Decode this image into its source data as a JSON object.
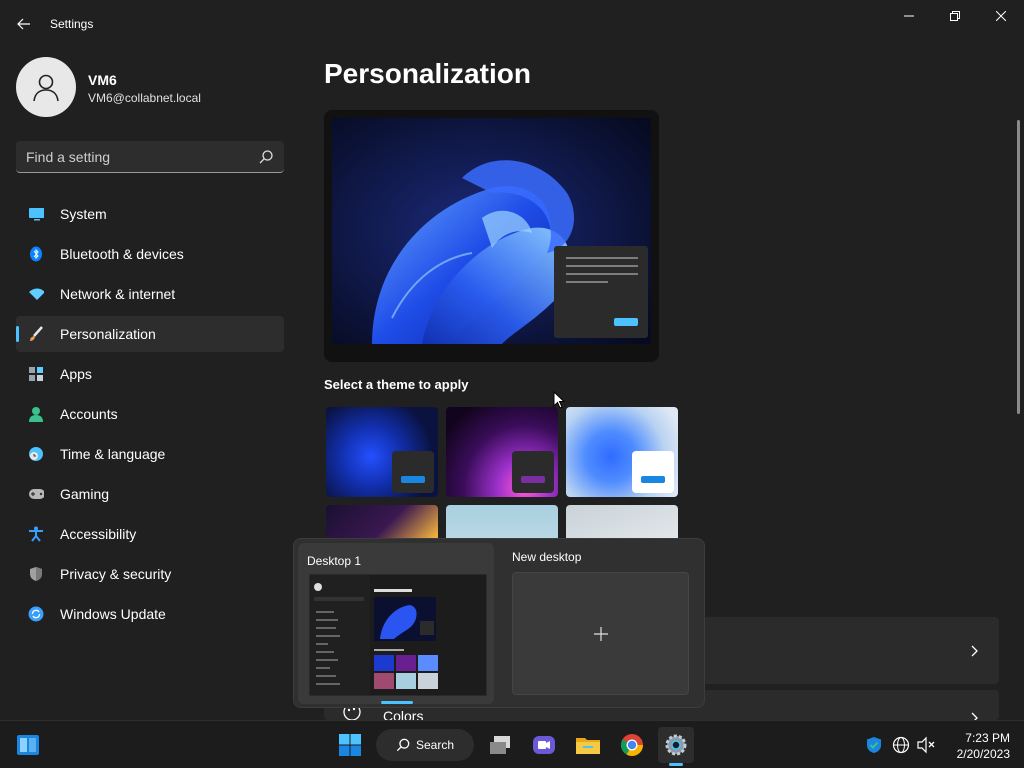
{
  "window": {
    "title": "Settings",
    "back_icon": "back-arrow-icon",
    "controls": [
      "minimize-icon",
      "restore-icon",
      "close-icon"
    ]
  },
  "user": {
    "name": "VM6",
    "email": "VM6@collabnet.local"
  },
  "search": {
    "placeholder": "Find a setting",
    "value": ""
  },
  "sidebar": {
    "items": [
      {
        "label": "System",
        "icon": "monitor-icon",
        "color": "#4cc2ff"
      },
      {
        "label": "Bluetooth & devices",
        "icon": "bluetooth-icon",
        "color": "#0a84ff"
      },
      {
        "label": "Network & internet",
        "icon": "wifi-icon",
        "color": "#60cdff"
      },
      {
        "label": "Personalization",
        "icon": "paintbrush-icon",
        "color": "#f0a052",
        "active": true
      },
      {
        "label": "Apps",
        "icon": "apps-icon",
        "color": "#9aa4b1"
      },
      {
        "label": "Accounts",
        "icon": "account-icon",
        "color": "#3ac18e"
      },
      {
        "label": "Time & language",
        "icon": "clock-globe-icon",
        "color": "#4cc2ff"
      },
      {
        "label": "Gaming",
        "icon": "gamepad-icon",
        "color": "#b8b8b8"
      },
      {
        "label": "Accessibility",
        "icon": "accessibility-icon",
        "color": "#3aa0ff"
      },
      {
        "label": "Privacy & security",
        "icon": "shield-icon",
        "color": "#a0a0a0"
      },
      {
        "label": "Windows Update",
        "icon": "refresh-icon",
        "color": "#3aa0ff"
      }
    ]
  },
  "main": {
    "title": "Personalization",
    "theme_heading": "Select a theme to apply",
    "themes": [
      {
        "icon": "theme-windows-dark",
        "accent": "#1a86e0"
      },
      {
        "icon": "theme-glow",
        "accent": "#7a2fa0"
      },
      {
        "icon": "theme-windows-light",
        "accent": "#1a86e0"
      },
      {
        "icon": "theme-captured-motion"
      },
      {
        "icon": "theme-sunrise"
      },
      {
        "icon": "theme-flow"
      }
    ],
    "colors_label": "Colors",
    "colors_icon": "palette-icon"
  },
  "task_view": {
    "desktop1_label": "Desktop 1",
    "new_desktop_label": "New desktop",
    "add_icon": "plus-icon"
  },
  "taskbar": {
    "search_label": "Search",
    "apps": [
      "start-icon",
      "task-view-icon",
      "teams-chat-icon",
      "file-explorer-icon",
      "chrome-icon",
      "settings-icon"
    ],
    "tray": [
      "defender-icon",
      "network-globe-icon",
      "volume-muted-icon"
    ],
    "time": "7:23 PM",
    "date": "2/20/2023"
  },
  "colors": {
    "accent": "#4cc2ff",
    "background": "#202020",
    "card": "#2b2b2b"
  }
}
